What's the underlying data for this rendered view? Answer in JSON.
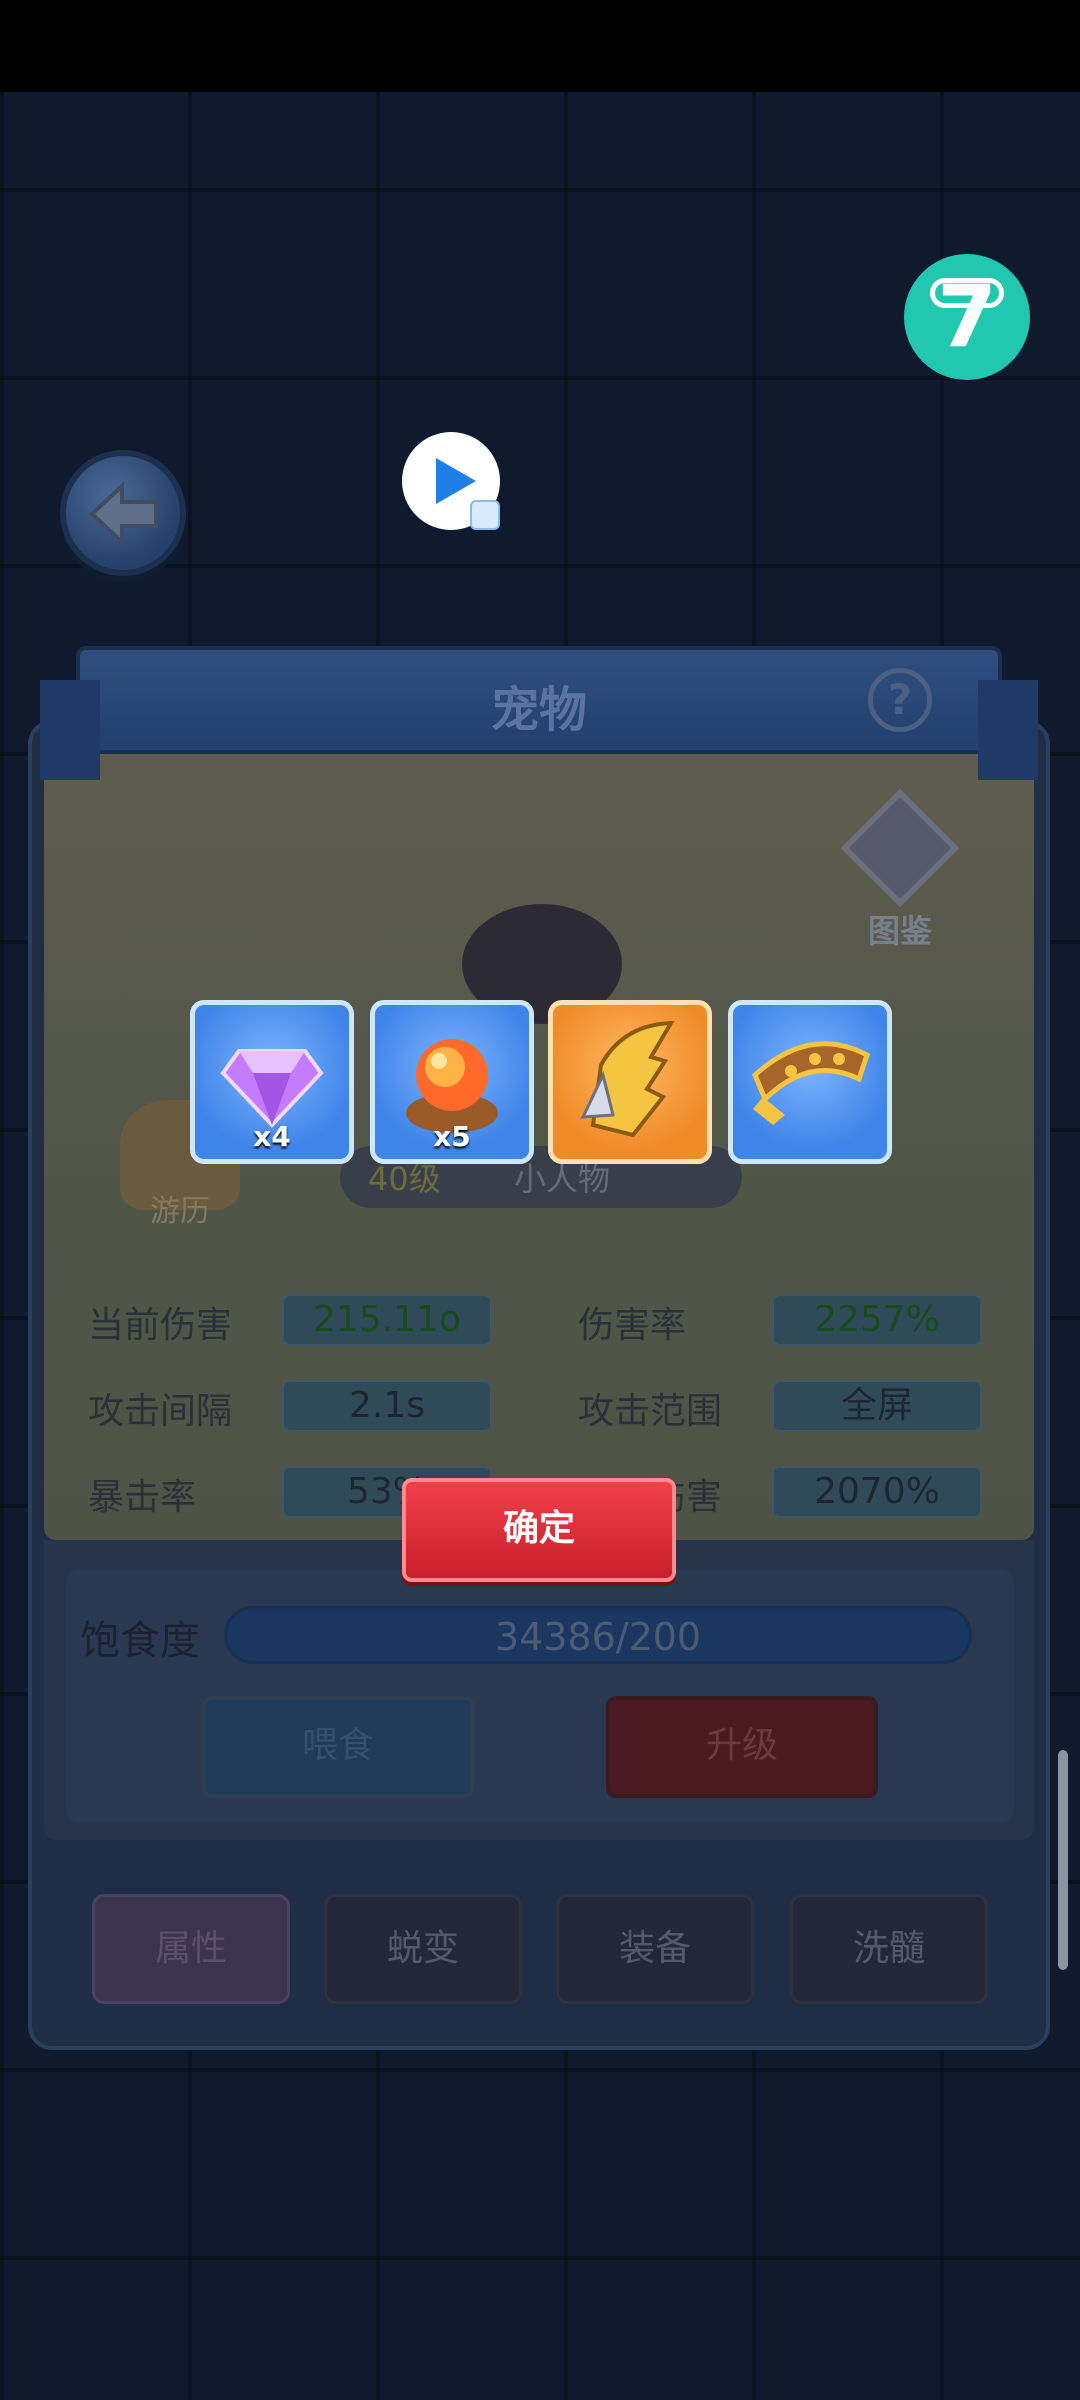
{
  "header": {
    "title": "宠物",
    "help": "?"
  },
  "side": {
    "tujian": "图鉴",
    "youli": "游历"
  },
  "pet": {
    "level": "40级",
    "name": "小人物"
  },
  "stats": [
    {
      "label": "当前伤害",
      "value": "215.11o"
    },
    {
      "label": "伤害率",
      "value": "2257%"
    },
    {
      "label": "攻击间隔",
      "value": "2.1s"
    },
    {
      "label": "攻击范围",
      "value": "全屏"
    },
    {
      "label": "暴击率",
      "value": "53%"
    },
    {
      "label": "暴击伤害",
      "value": "2070%"
    }
  ],
  "satiety": {
    "label": "饱食度",
    "value": "34386/200",
    "fill": 1.0
  },
  "buttons": {
    "feed": "喂食",
    "upgrade": "升级",
    "confirm": "确定"
  },
  "tabs": [
    "属性",
    "蜕变",
    "装备",
    "洗髓"
  ],
  "rewards": [
    {
      "icon": "purple-gem-icon",
      "count": "x4"
    },
    {
      "icon": "fire-orb-icon",
      "count": "x5"
    },
    {
      "icon": "golden-helmet-icon",
      "count": ""
    },
    {
      "icon": "golden-belt-icon",
      "count": ""
    }
  ],
  "colors": {
    "confirm": "#e02c38",
    "logo": "#22c7b0",
    "reward_blue": "#4a8ef0",
    "reward_orange": "#f39a3b"
  }
}
